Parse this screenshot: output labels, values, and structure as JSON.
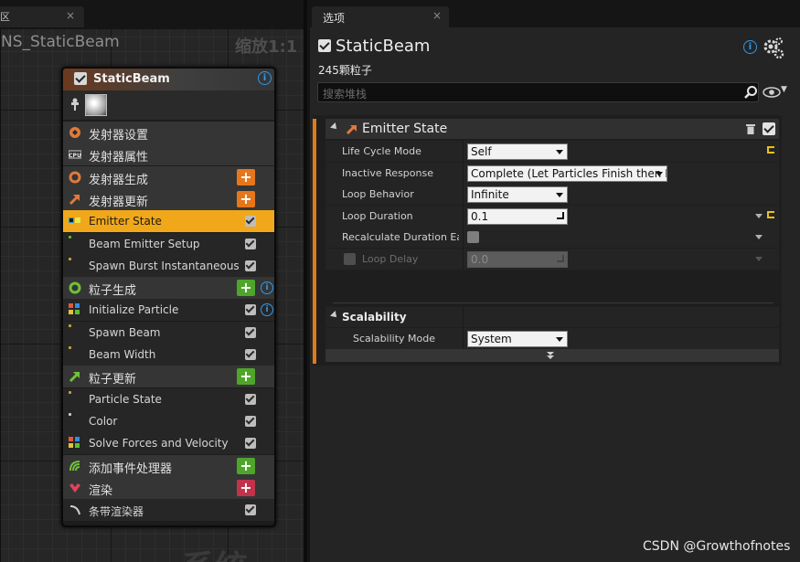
{
  "left_tab": {
    "label": "区",
    "close": "×"
  },
  "graph": {
    "title": "NS_StaticBeam",
    "zoom": "缩放1:1",
    "watermark": "系统"
  },
  "node": {
    "title": "StaticBeam",
    "rows": [
      {
        "label": "发射器设置",
        "kind": "group",
        "icon": "emitter-settings-icon"
      },
      {
        "label": "发射器属性",
        "kind": "group",
        "icon": "cpu-icon",
        "icon_text": "CPU"
      },
      {
        "label": "发射器生成",
        "kind": "group",
        "icon": "emitter-spawn-icon",
        "add_color": "#e6761c"
      },
      {
        "label": "发射器更新",
        "kind": "group",
        "icon": "emitter-update-icon",
        "add_color": "#e6761c"
      },
      {
        "label": "Emitter State",
        "kind": "selected",
        "icon": "emitter-state-icon"
      },
      {
        "label": "Beam Emitter Setup",
        "kind": "item",
        "dot": "#5fbf32"
      },
      {
        "label": "Spawn Burst Instantaneous",
        "kind": "item",
        "dot": "#c9a33a"
      },
      {
        "label": "粒子生成",
        "kind": "group",
        "icon": "particle-spawn-icon",
        "add_color": "#4ea52a"
      },
      {
        "label": "Initialize Particle",
        "kind": "item",
        "dot": "multi"
      },
      {
        "label": "Spawn Beam",
        "kind": "item",
        "dot": "#c9a33a"
      },
      {
        "label": "Beam Width",
        "kind": "item",
        "dot": "#c9a33a"
      },
      {
        "label": "粒子更新",
        "kind": "group",
        "icon": "particle-update-icon",
        "add_color": "#4ea52a"
      },
      {
        "label": "Particle State",
        "kind": "item",
        "dot": "#c9a33a"
      },
      {
        "label": "Color",
        "kind": "item",
        "dot": "#cfcfcf"
      },
      {
        "label": "Solve Forces and Velocity",
        "kind": "item",
        "dot": "multi"
      },
      {
        "label": "添加事件处理器",
        "kind": "group",
        "icon": "event-handler-icon",
        "add_color": "#4ea52a"
      },
      {
        "label": "渲染",
        "kind": "group",
        "icon": "render-icon",
        "add_color": "#c0334a"
      },
      {
        "label": "条带渲染器",
        "kind": "item",
        "icon": "ribbon-renderer-icon"
      }
    ]
  },
  "details": {
    "tab_label": "选项",
    "tab_close": "×",
    "object_name": "StaticBeam",
    "particle_count": "245颗粒子",
    "search_placeholder": "搜索堆栈",
    "category_title": "Emitter State",
    "properties": [
      {
        "name": "Life Cycle Mode",
        "type": "combo",
        "value": "Self",
        "reset": true
      },
      {
        "name": "Inactive Response",
        "type": "combo",
        "value": "Complete (Let Particles Finish then K"
      },
      {
        "name": "Loop Behavior",
        "type": "combo",
        "value": "Infinite"
      },
      {
        "name": "Loop Duration",
        "type": "number",
        "value": "0.1",
        "reset": true,
        "dropdown": true
      },
      {
        "name": "Recalculate Duration Eac",
        "type": "checkbox",
        "dropdown": true
      },
      {
        "name": "Loop Delay",
        "type": "number",
        "value": "0.0",
        "disabled": true,
        "dropdown": true
      }
    ],
    "scalability_title": "Scalability",
    "scalability_mode_label": "Scalability Mode",
    "scalability_mode_value": "System"
  },
  "watermark": "CSDN @Growthofnotes",
  "colors": {
    "accent_orange": "#e07a1a",
    "selected_row": "#f0a81a",
    "info_blue": "#2e9bf0"
  }
}
